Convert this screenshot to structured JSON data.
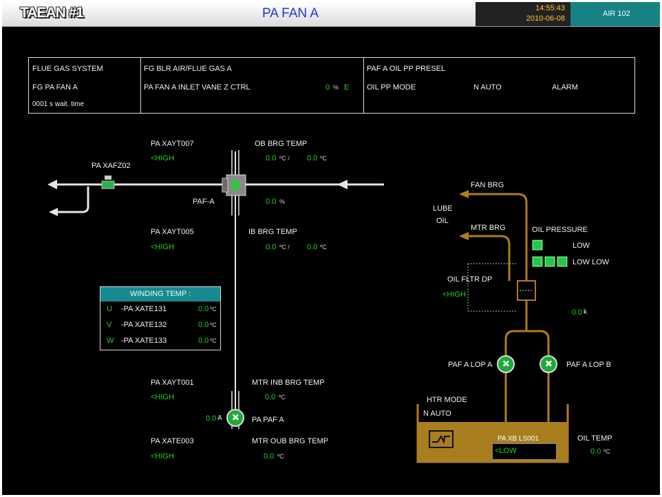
{
  "header": {
    "plant": "TAEAN #1",
    "title": "PA FAN A",
    "time": "14:55:43",
    "date": "2010-06-08",
    "air": "AIR 102"
  },
  "info": {
    "col1": {
      "line1": "FLUE GAS SYSTEM",
      "line2": "FG PA FAN A",
      "line3": "0001  s wait. time"
    },
    "col2": {
      "line1": "FG BLR AIR/FLUE GAS A",
      "ctrl_label": "PA FAN A INLET VANE Z CTRL",
      "ctrl_value": "0",
      "ctrl_unit": "%",
      "ctrl_mode": "E"
    },
    "col3": {
      "line1": "PAF A OIL PP PRESEL",
      "mode_label": "OIL PP MODE",
      "mode_value": "N AUTO",
      "alarm": "ALARM"
    }
  },
  "fan": {
    "damper_tag": "PA XAFZ02",
    "fan_label": "PAF-A",
    "fan_value": "0.0",
    "fan_unit": "%"
  },
  "ob_brg": {
    "tag": "PA XAYT007",
    "status": "<HIGH",
    "title": "OB BRG TEMP",
    "v1": "0.0",
    "u1": "ºC /",
    "v2": "0.0",
    "u2": "ºC"
  },
  "ib_brg": {
    "tag": "PA XAYT005",
    "status": "<HIGH",
    "title": "IB BRG TEMP",
    "v1": "0.0",
    "u1": "ºC /",
    "v2": "0.0",
    "u2": "ºC"
  },
  "winding": {
    "title": "WINDING TEMP :",
    "rows": [
      {
        "phase": "U",
        "tag": "-PA XATE131",
        "value": "0.0",
        "unit": "ºC"
      },
      {
        "phase": "V",
        "tag": "-PA XATE132",
        "value": "0.0",
        "unit": "ºC"
      },
      {
        "phase": "W",
        "tag": "-PA XATE133",
        "value": "0.0",
        "unit": "ºC"
      }
    ]
  },
  "motor": {
    "inb_tag": "PA XAYT001",
    "inb_status": "<HIGH",
    "inb_title": "MTR INB BRG TEMP",
    "inb_value": "0.0",
    "inb_unit": "ºC",
    "current_value": "0.0",
    "current_unit": "A",
    "name": "PA PAF A",
    "oub_tag": "PA XATE003",
    "oub_status": "<HIGH",
    "oub_title": "MTR OUB BRG TEMP",
    "oub_value": "0.0",
    "oub_unit": "ºC"
  },
  "lube": {
    "fan_brg": "FAN BRG",
    "mtr_brg": "MTR BRG",
    "lube_oil_1": "LUBE",
    "lube_oil_2": "OIL",
    "oil_pressure": "OIL PRESSURE",
    "low": "LOW",
    "low_low": "LOW LOW",
    "fltr_dp": "OIL FLTR DP",
    "fltr_status": "<HIGH",
    "dp_value": "0.0",
    "dp_unit": "k",
    "lop_a": "PAF A LOP A",
    "lop_b": "PAF A LOP B",
    "htr_mode": "HTR MODE",
    "htr_mode_value": "N AUTO",
    "level_tag": "PA XB LS001",
    "level_status": "<LOW",
    "oil_temp_label": "OIL TEMP",
    "oil_temp_value": "0.0",
    "oil_temp_unit": "ºC"
  },
  "colors": {
    "background": "#000000",
    "value_green": "#22d622",
    "oil_line": "#b07d1c",
    "teal": "#168a90",
    "title_blue": "#1f34d8"
  }
}
